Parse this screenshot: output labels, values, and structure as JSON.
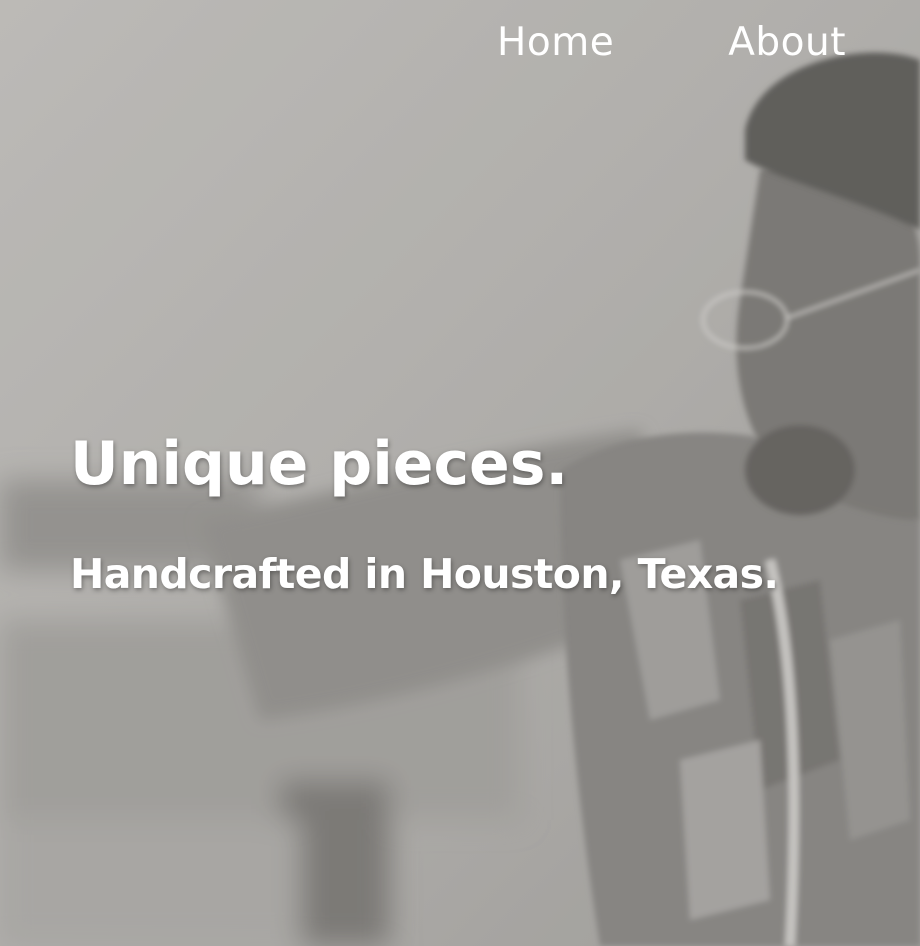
{
  "nav": {
    "items": [
      {
        "label": "Home"
      },
      {
        "label": "About"
      }
    ]
  },
  "hero": {
    "headline": "Unique pieces.",
    "subheadline": "Handcrafted in Houston, Texas."
  },
  "colors": {
    "overlay_gray": "#a9a8a4",
    "text": "#ffffff"
  }
}
